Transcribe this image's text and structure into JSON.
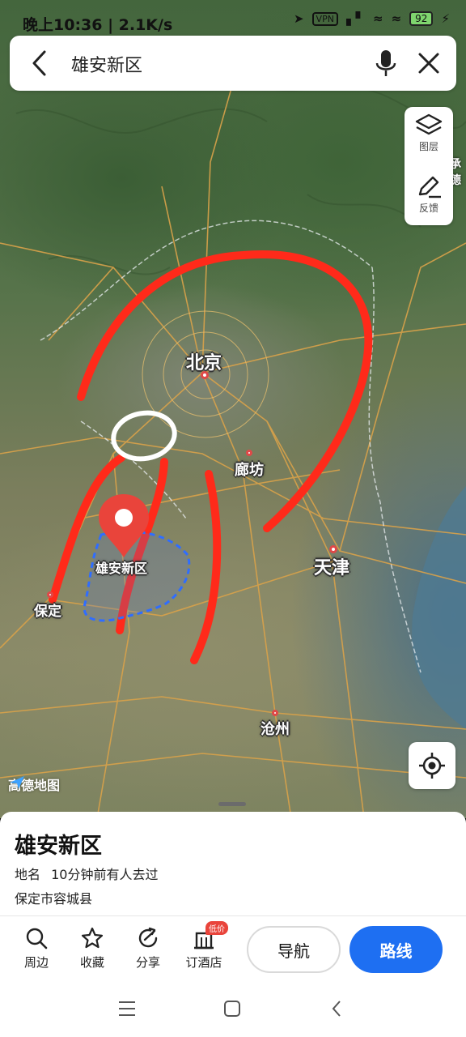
{
  "status_bar": {
    "time_speed": "晚上10:36 | 2.1K/s",
    "vpn": "VPN",
    "battery": "92"
  },
  "search": {
    "query": "雄安新区"
  },
  "map_tools": {
    "layers_label": "图层",
    "feedback_label": "反馈"
  },
  "map": {
    "brand": "高德地图",
    "cities": {
      "beijing": "北京",
      "tianjin": "天津",
      "langfang": "廊坊",
      "xiongan": "雄安新区",
      "baoding": "保定",
      "cangzhou": "沧州",
      "edge": "承德"
    },
    "annotation_color": "#ff2a1a",
    "selection_color": "#2f6dff"
  },
  "place": {
    "title": "雄安新区",
    "category": "地名",
    "recent": "10分钟前有人去过",
    "address": "保定市容城县"
  },
  "actions": {
    "nearby": "周边",
    "favorite": "收藏",
    "share": "分享",
    "hotel": "订酒店",
    "hotel_badge": "低价",
    "navigate": "导航",
    "route": "路线"
  },
  "colors": {
    "accent": "#1e6ff2",
    "pin": "#e9443b"
  }
}
